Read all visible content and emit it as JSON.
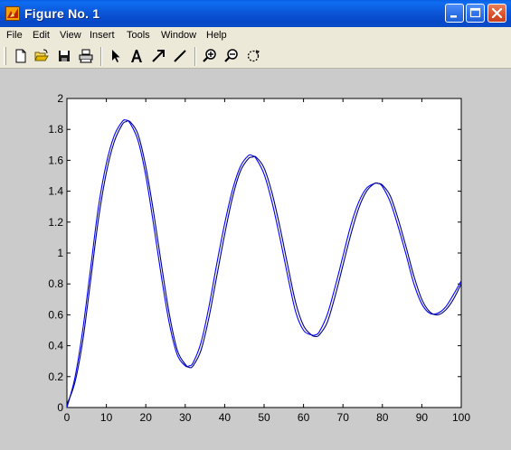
{
  "window": {
    "title": "Figure No. 1",
    "buttons": [
      "minimize",
      "maximize",
      "close"
    ]
  },
  "menu": [
    "File",
    "Edit",
    "View",
    "Insert",
    "Tools",
    "Window",
    "Help"
  ],
  "toolbar": {
    "buttons": [
      "new-figure-icon",
      "open-file-icon",
      "save-icon",
      "print-icon",
      "select-arrow-icon",
      "insert-text-icon",
      "insert-arrow-icon",
      "insert-line-icon",
      "zoom-in-icon",
      "zoom-out-icon",
      "rotate-3d-icon"
    ]
  },
  "colors": {
    "title_bar": "#0b57d8",
    "figure_bg": "#cbcbcb",
    "line": "#0000ff",
    "line2": "#00007f"
  },
  "chart_data": {
    "type": "line",
    "title": "",
    "xlabel": "",
    "ylabel": "",
    "xlim": [
      0,
      100
    ],
    "ylim": [
      0,
      2
    ],
    "xticks": [
      0,
      10,
      20,
      30,
      40,
      50,
      60,
      70,
      80,
      90,
      100
    ],
    "yticks": [
      0,
      0.2,
      0.4,
      0.6,
      0.8,
      1,
      1.2,
      1.4,
      1.6,
      1.8,
      2
    ],
    "xtick_labels": [
      "0",
      "10",
      "20",
      "30",
      "40",
      "50",
      "60",
      "70",
      "80",
      "90",
      "100"
    ],
    "ytick_labels": [
      "0",
      "0.2",
      "0.4",
      "0.6",
      "0.8",
      "1",
      "1.2",
      "1.4",
      "1.6",
      "1.8",
      "2"
    ],
    "grid": false,
    "series": [
      {
        "color": "#0000ff",
        "x": [
          0,
          2,
          4,
          6,
          8,
          10,
          12,
          14,
          15,
          16,
          18,
          20,
          22,
          24,
          26,
          28,
          30,
          31,
          32,
          34,
          36,
          38,
          40,
          42,
          44,
          46,
          47,
          48,
          50,
          52,
          54,
          56,
          58,
          60,
          62,
          63,
          64,
          66,
          68,
          70,
          72,
          74,
          76,
          78,
          79,
          80,
          82,
          84,
          86,
          88,
          90,
          92,
          94,
          96,
          98,
          100
        ],
        "y": [
          0,
          0.19,
          0.5,
          0.9,
          1.3,
          1.58,
          1.76,
          1.85,
          1.86,
          1.84,
          1.73,
          1.5,
          1.18,
          0.84,
          0.54,
          0.34,
          0.27,
          0.27,
          0.29,
          0.42,
          0.65,
          0.93,
          1.19,
          1.41,
          1.56,
          1.63,
          1.63,
          1.61,
          1.51,
          1.33,
          1.1,
          0.85,
          0.62,
          0.5,
          0.47,
          0.47,
          0.49,
          0.6,
          0.78,
          0.98,
          1.18,
          1.33,
          1.42,
          1.45,
          1.45,
          1.43,
          1.33,
          1.17,
          0.99,
          0.8,
          0.67,
          0.61,
          0.61,
          0.65,
          0.73,
          0.82
        ]
      },
      {
        "color": "#00007f",
        "x": [
          0,
          2,
          4,
          6,
          8,
          10,
          12,
          14,
          15,
          16,
          18,
          20,
          22,
          24,
          26,
          28,
          30,
          31,
          32,
          34,
          36,
          38,
          40,
          42,
          44,
          46,
          47,
          48,
          50,
          52,
          54,
          56,
          58,
          60,
          62,
          63,
          64,
          66,
          68,
          70,
          72,
          74,
          76,
          78,
          79,
          80,
          82,
          84,
          86,
          88,
          90,
          92,
          94,
          96,
          98,
          100
        ],
        "y": [
          0.02,
          0.16,
          0.43,
          0.82,
          1.22,
          1.52,
          1.72,
          1.83,
          1.85,
          1.85,
          1.77,
          1.56,
          1.26,
          0.92,
          0.6,
          0.37,
          0.28,
          0.26,
          0.27,
          0.37,
          0.58,
          0.85,
          1.12,
          1.36,
          1.53,
          1.61,
          1.62,
          1.62,
          1.55,
          1.39,
          1.17,
          0.92,
          0.68,
          0.53,
          0.47,
          0.46,
          0.47,
          0.55,
          0.72,
          0.92,
          1.12,
          1.29,
          1.4,
          1.45,
          1.45,
          1.44,
          1.37,
          1.22,
          1.04,
          0.85,
          0.7,
          0.62,
          0.6,
          0.63,
          0.7,
          0.8
        ]
      }
    ]
  }
}
